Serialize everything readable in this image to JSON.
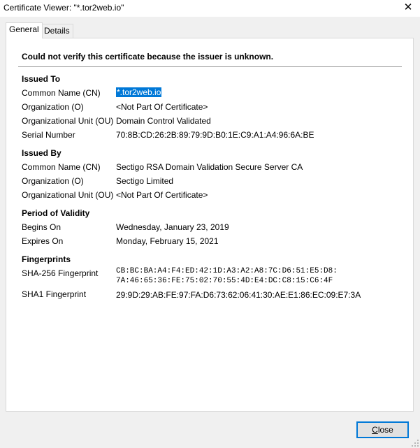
{
  "window": {
    "title": "Certificate Viewer: \"*.tor2web.io\"",
    "close_glyph": "✕"
  },
  "tabs": [
    {
      "label": "General",
      "active": true
    },
    {
      "label": "Details",
      "active": false
    }
  ],
  "warning": "Could not verify this certificate because the issuer is unknown.",
  "issued_to": {
    "title": "Issued To",
    "fields": [
      {
        "label": "Common Name (CN)",
        "value": "*.tor2web.io"
      },
      {
        "label": "Organization (O)",
        "value": "<Not Part Of Certificate>"
      },
      {
        "label": "Organizational Unit (OU)",
        "value": "Domain Control Validated"
      },
      {
        "label": "Serial Number",
        "value": "70:8B:CD:26:2B:89:79:9D:B0:1E:C9:A1:A4:96:6A:BE"
      }
    ]
  },
  "issued_by": {
    "title": "Issued By",
    "fields": [
      {
        "label": "Common Name (CN)",
        "value": "Sectigo RSA Domain Validation Secure Server CA"
      },
      {
        "label": "Organization (O)",
        "value": "Sectigo Limited"
      },
      {
        "label": "Organizational Unit (OU)",
        "value": "<Not Part Of Certificate>"
      }
    ]
  },
  "validity": {
    "title": "Period of Validity",
    "fields": [
      {
        "label": "Begins On",
        "value": "Wednesday, January 23, 2019"
      },
      {
        "label": "Expires On",
        "value": "Monday, February 15, 2021"
      }
    ]
  },
  "fingerprints": {
    "title": "Fingerprints",
    "sha256_label": "SHA-256 Fingerprint",
    "sha256_line1": "CB:BC:BA:A4:F4:ED:42:1D:A3:A2:A8:7C:D6:51:E5:D8:",
    "sha256_line2": "7A:46:65:36:FE:75:02:70:55:4D:E4:DC:C8:15:C6:4F",
    "sha1_label": "SHA1 Fingerprint",
    "sha1_value": "29:9D:29:AB:FE:97:FA:D6:73:62:06:41:30:AE:E1:86:EC:09:E7:3A"
  },
  "buttons": {
    "close_accesskey": "C",
    "close_rest": "lose"
  }
}
